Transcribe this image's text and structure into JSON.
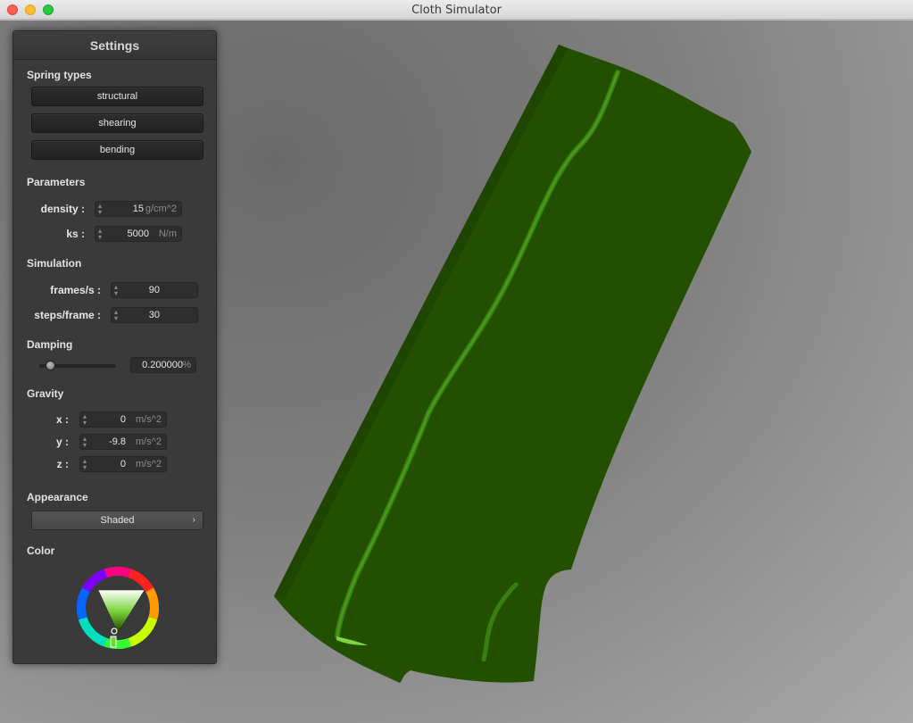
{
  "window": {
    "title": "Cloth Simulator"
  },
  "panel": {
    "title": "Settings",
    "spring_types": {
      "title": "Spring types",
      "buttons": [
        "structural",
        "shearing",
        "bending"
      ]
    },
    "parameters": {
      "title": "Parameters",
      "density": {
        "label": "density :",
        "value": "15",
        "unit": "g/cm^2"
      },
      "ks": {
        "label": "ks :",
        "value": "5000",
        "unit": "N/m"
      }
    },
    "simulation": {
      "title": "Simulation",
      "fps": {
        "label": "frames/s :",
        "value": "90"
      },
      "steps": {
        "label": "steps/frame :",
        "value": "30"
      }
    },
    "damping": {
      "title": "Damping",
      "value": "0.200000",
      "unit": "%",
      "slider_fraction": 0.2
    },
    "gravity": {
      "title": "Gravity",
      "x": {
        "label": "x :",
        "value": "0",
        "unit": "m/s^2"
      },
      "y": {
        "label": "y :",
        "value": "-9.8",
        "unit": "m/s^2"
      },
      "z": {
        "label": "z :",
        "value": "0",
        "unit": "m/s^2"
      }
    },
    "appearance": {
      "title": "Appearance",
      "selected": "Shaded"
    },
    "color": {
      "title": "Color",
      "value": "#2d6a00"
    }
  },
  "colors": {
    "cloth": "#235000",
    "cloth_highlight": "#3f8a16",
    "panel_bg": "#3a3a3a"
  }
}
